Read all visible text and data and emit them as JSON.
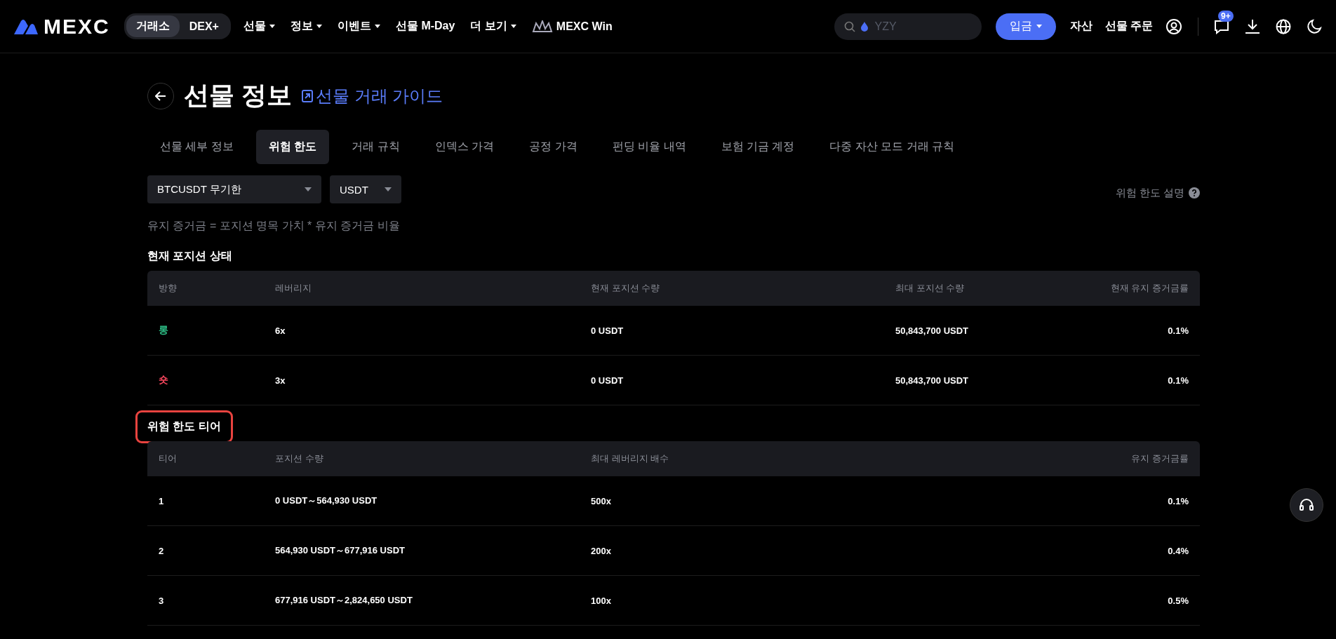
{
  "header": {
    "logo": "MEXC",
    "switch": [
      {
        "label": "거래소",
        "selected": true
      },
      {
        "label": "DEX+",
        "selected": false
      }
    ],
    "nav": [
      {
        "label": "선물",
        "kind": "menu"
      },
      {
        "label": "정보",
        "kind": "menu"
      },
      {
        "label": "이벤트",
        "kind": "menu"
      },
      {
        "label": "선물 M-Day",
        "kind": "link"
      },
      {
        "label": "더 보기",
        "kind": "menu"
      },
      {
        "label": "MEXC Win",
        "kind": "win"
      }
    ],
    "search": {
      "placeholder": "YZY"
    },
    "deposit": "입금",
    "links": [
      "자산",
      "선물 주문"
    ],
    "badge": "9+"
  },
  "page": {
    "title": "선물 정보",
    "guide": "선물 거래 가이드",
    "tabs": [
      {
        "label": "선물 세부 정보",
        "selected": false
      },
      {
        "label": "위험 한도",
        "selected": true
      },
      {
        "label": "거래 규칙",
        "selected": false
      },
      {
        "label": "인덱스 가격",
        "selected": false
      },
      {
        "label": "공정 가격",
        "selected": false
      },
      {
        "label": "펀딩 비율 내역",
        "selected": false
      },
      {
        "label": "보험 기금 계정",
        "selected": false
      },
      {
        "label": "다중 자산 모드 거래 규칙",
        "selected": false
      }
    ],
    "selects": [
      "BTCUSDT 무기한",
      "USDT"
    ],
    "help": "위험 한도 설명",
    "formula": "유지 증거금 = 포지션 명목 가치 * 유지 증거금 비율"
  },
  "position": {
    "title": "현재 포지션 상태",
    "columns": [
      "방향",
      "레버리지",
      "현재 포지션 수량",
      "최대 포지션 수량",
      "현재 유지 증거금률"
    ],
    "rows": [
      {
        "color": "#2dbd85",
        "cells": [
          "롱",
          "6x",
          "0 USDT",
          "50,843,700 USDT",
          "0.1%"
        ]
      },
      {
        "color": "#f6465d",
        "cells": [
          "숏",
          "3x",
          "0 USDT",
          "50,843,700 USDT",
          "0.1%"
        ]
      }
    ]
  },
  "tiers": {
    "title": "위험 한도 티어",
    "highlighted": true,
    "columns": [
      "티어",
      "포지션 수량",
      "최대 레버리지 배수",
      "유지 증거금률"
    ],
    "rows": [
      [
        "1",
        "0 USDT～564,930 USDT",
        "500x",
        "0.1%"
      ],
      [
        "2",
        "564,930 USDT～677,916 USDT",
        "200x",
        "0.4%"
      ],
      [
        "3",
        "677,916 USDT～2,824,650 USDT",
        "100x",
        "0.5%"
      ]
    ]
  }
}
